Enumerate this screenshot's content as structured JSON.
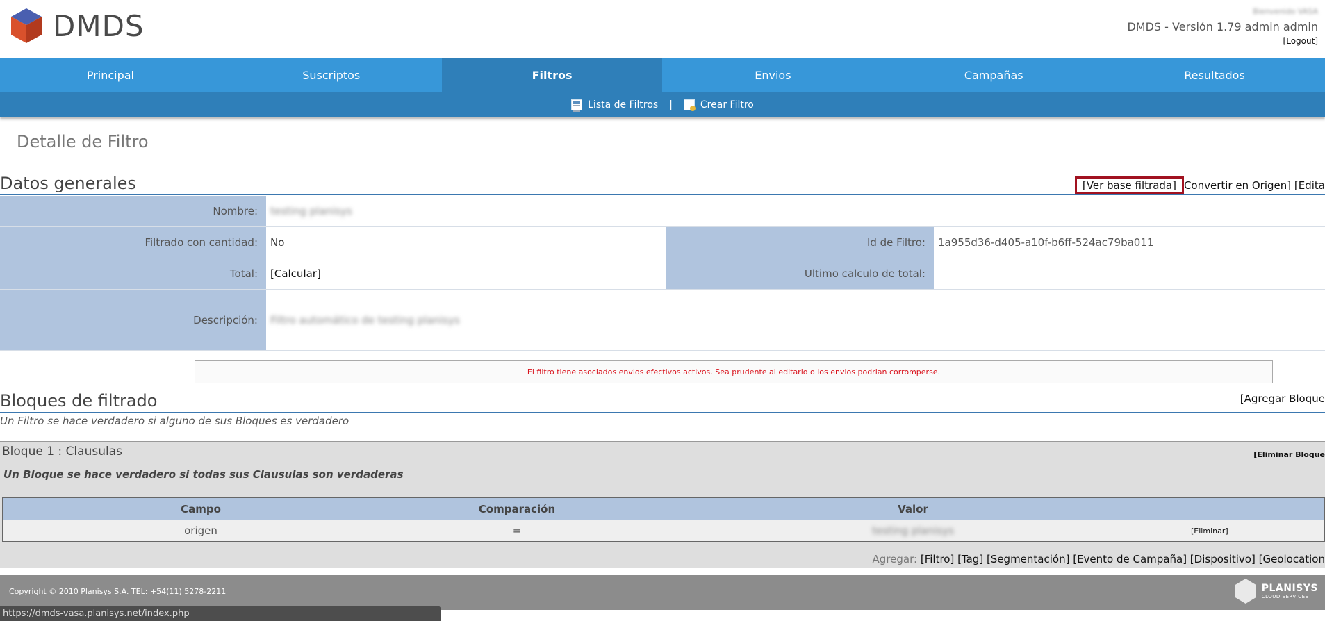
{
  "header": {
    "brand": "DMDS",
    "welcome": "Bienvenido VASA",
    "version": "DMDS - Versión 1.79 admin admin",
    "logout": "[Logout]"
  },
  "nav": {
    "tabs": [
      {
        "label": "Principal"
      },
      {
        "label": "Suscriptos"
      },
      {
        "label": "Filtros",
        "active": true
      },
      {
        "label": "Envios"
      },
      {
        "label": "Campañas"
      },
      {
        "label": "Resultados"
      }
    ],
    "sub": {
      "list": "Lista de Filtros",
      "sep": "|",
      "create": "Crear Filtro"
    }
  },
  "page": {
    "title": "Detalle de Filtro"
  },
  "general": {
    "title": "Datos generales",
    "links": {
      "ver_base": "[Ver base filtrada]",
      "convertir": "Convertir en Origen]",
      "editar": "[Edita"
    },
    "fields": {
      "nombre_label": "Nombre:",
      "nombre_value": "testing planisys",
      "filtrado_label": "Filtrado con cantidad:",
      "filtrado_value": "No",
      "id_label": "Id de Filtro:",
      "id_value": "1a955d36-d405-a10f-b6ff-524ac79ba011",
      "total_label": "Total:",
      "total_value": "[Calcular]",
      "ultimo_label": "Ultimo calculo de total:",
      "ultimo_value": "",
      "descripcion_label": "Descripción:",
      "descripcion_value": "Filtro automático de testing planisys"
    },
    "warning": "El filtro tiene asociados envios efectivos activos. Sea prudente al editarlo o los envios podrian corromperse."
  },
  "bloques": {
    "title": "Bloques de filtrado",
    "add": "[Agregar Bloque",
    "note": "Un Filtro se hace verdadero si alguno de sus Bloques es verdadero",
    "block1": {
      "title": "Bloque 1 : Clausulas",
      "delete": "[Eliminar Bloque",
      "desc": "Un Bloque se hace verdadero si todas sus Clausulas son verdaderas",
      "headers": [
        "Campo",
        "Comparación",
        "Valor"
      ],
      "rows": [
        {
          "campo": "origen",
          "comparacion": "=",
          "valor": "testing planisys",
          "action": "[Eliminar]"
        }
      ],
      "add_label": "Agregar:",
      "add_links": "[Filtro] [Tag] [Segmentación] [Evento de Campaña] [Dispositivo] [Geolocation"
    }
  },
  "footer": {
    "copyright": "Copyright © 2010 Planisys S.A. TEL: +54(11) 5278-2211",
    "logo_main": "PLANISYS",
    "logo_sub": "CLOUD SERVICES"
  },
  "statusbar": {
    "url": "https://dmds-vasa.planisys.net/index.php"
  },
  "colors": {
    "nav": "#3797d9",
    "nav_active": "#2f7fb9",
    "label_bg": "#b0c4de",
    "warning_text": "#d9131d",
    "highlight_border": "#a11220"
  }
}
